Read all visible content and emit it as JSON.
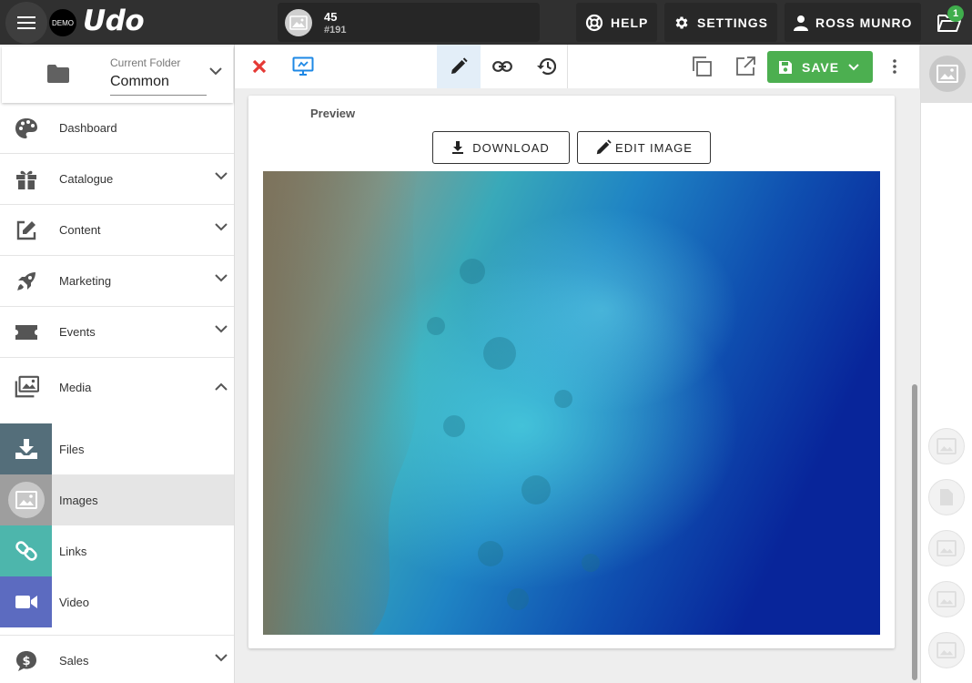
{
  "topbar": {
    "logo_badge": "DEMO",
    "app_name": "Udo",
    "record_number": "45",
    "record_id": "#191",
    "help_label": "HELP",
    "settings_label": "SETTINGS",
    "user_label": "ROSS MUNRO",
    "notification_count": "1"
  },
  "folder": {
    "caption": "Current Folder",
    "value": "Common"
  },
  "sidebar": {
    "items": [
      {
        "label": "Dashboard"
      },
      {
        "label": "Catalogue"
      },
      {
        "label": "Content"
      },
      {
        "label": "Marketing"
      },
      {
        "label": "Events"
      },
      {
        "label": "Media"
      }
    ],
    "media_sub": [
      {
        "label": "Files",
        "color": "#546e7a"
      },
      {
        "label": "Images",
        "color": "#9e9e9e"
      },
      {
        "label": "Links",
        "color": "#4db6ac"
      },
      {
        "label": "Video",
        "color": "#5c6bc0"
      }
    ],
    "sales_label": "Sales"
  },
  "toolbar": {
    "save_label": "SAVE"
  },
  "main": {
    "preview_label": "Preview",
    "download_label": "DOWNLOAD",
    "edit_image_label": "EDIT IMAGE"
  },
  "colors": {
    "accent_green": "#4caf50",
    "close_red": "#e53935",
    "active_blue": "#1e88e5"
  }
}
